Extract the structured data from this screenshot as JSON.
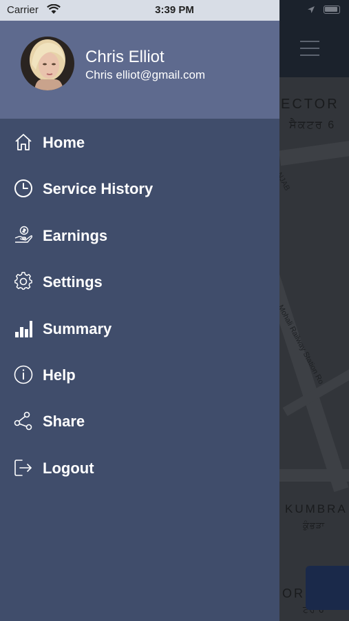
{
  "status_bar": {
    "carrier": "Carrier",
    "time": "3:39 PM"
  },
  "profile": {
    "name": "Chris Elliot",
    "email": "Chris elliot@gmail.com"
  },
  "menu": {
    "items": [
      {
        "label": "Home",
        "icon": "home-icon"
      },
      {
        "label": "Service History",
        "icon": "clock-icon"
      },
      {
        "label": "Earnings",
        "icon": "earnings-icon"
      },
      {
        "label": "Settings",
        "icon": "gear-icon"
      },
      {
        "label": "Summary",
        "icon": "bar-chart-icon"
      },
      {
        "label": "Help",
        "icon": "info-icon"
      },
      {
        "label": "Share",
        "icon": "share-icon"
      },
      {
        "label": "Logout",
        "icon": "logout-icon"
      }
    ]
  },
  "map": {
    "labels": [
      "ECTOR",
      "ਸੈਕਟਰ 6",
      "KUMBRA",
      "ਕੁੰਭੜਾ",
      "Mohali Railway Station Ro",
      "NJAB",
      "OR",
      "ਟਰ 6"
    ]
  },
  "colors": {
    "drawer": "#404d6b",
    "profile_header": "#5e6a8e",
    "map_header": "#1f2733",
    "accent_button": "#1e2f55"
  }
}
